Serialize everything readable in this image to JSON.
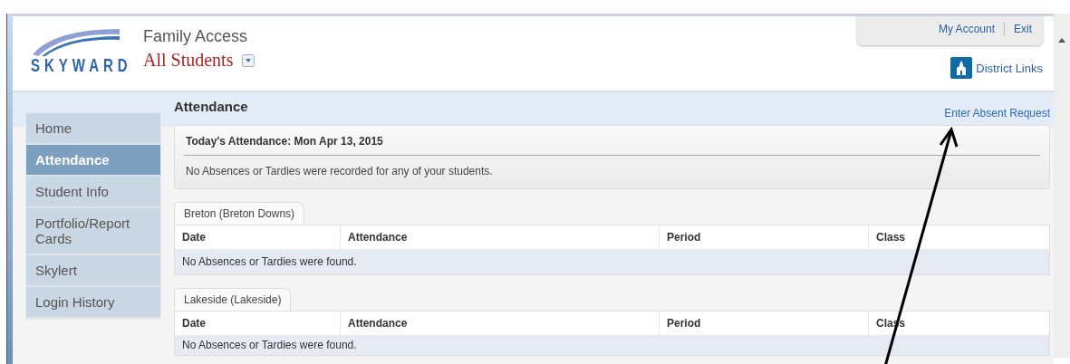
{
  "header": {
    "logo_text": "SKYWARD",
    "app_title": "Family Access",
    "student_selector": "All Students",
    "account_links": [
      "My Account",
      "Exit"
    ],
    "district_links": "District Links"
  },
  "sidebar": {
    "items": [
      {
        "label": "Home",
        "selected": false
      },
      {
        "label": "Attendance",
        "selected": true
      },
      {
        "label": "Student Info",
        "selected": false
      },
      {
        "label": "Portfolio/Report Cards",
        "selected": false
      },
      {
        "label": "Skylert",
        "selected": false
      },
      {
        "label": "Login History",
        "selected": false
      }
    ]
  },
  "page_title": "Attendance",
  "action_link": "Enter Absent Request",
  "today": {
    "heading": "Today's Attendance: Mon Apr 13, 2015",
    "message": "No Absences or Tardies were recorded for any of your students."
  },
  "schools": [
    {
      "name": "Breton (Breton Downs)",
      "columns": [
        "Date",
        "Attendance",
        "Period",
        "Class"
      ],
      "message": "No Absences or Tardies were found."
    },
    {
      "name": "Lakeside (Lakeside)",
      "columns": [
        "Date",
        "Attendance",
        "Period",
        "Class"
      ],
      "message": "No Absences or Tardies were found."
    }
  ]
}
